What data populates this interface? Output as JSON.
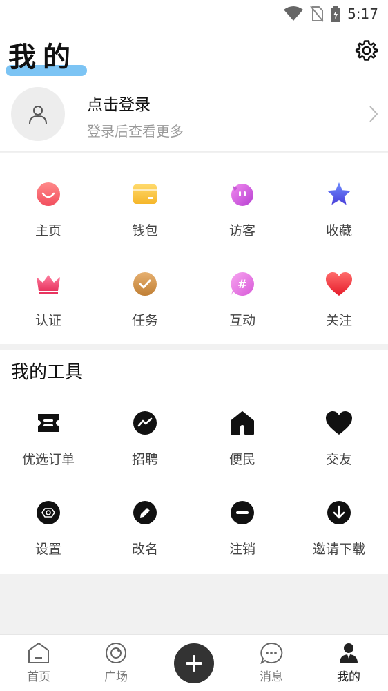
{
  "status_bar": {
    "time": "5:17"
  },
  "header": {
    "title": "我的"
  },
  "profile": {
    "title": "点击登录",
    "subtitle": "登录后查看更多"
  },
  "quick_items": [
    {
      "label": "主页",
      "icon": "smile-icon"
    },
    {
      "label": "钱包",
      "icon": "wallet-icon"
    },
    {
      "label": "访客",
      "icon": "visitor-icon"
    },
    {
      "label": "收藏",
      "icon": "star-icon"
    },
    {
      "label": "认证",
      "icon": "crown-icon"
    },
    {
      "label": "任务",
      "icon": "check-icon"
    },
    {
      "label": "互动",
      "icon": "hashtag-icon"
    },
    {
      "label": "关注",
      "icon": "heart-icon"
    }
  ],
  "tools": {
    "title": "我的工具",
    "items": [
      {
        "label": "优选订单",
        "icon": "ticket-icon"
      },
      {
        "label": "招聘",
        "icon": "trend-icon"
      },
      {
        "label": "便民",
        "icon": "home-icon"
      },
      {
        "label": "交友",
        "icon": "heart-icon"
      },
      {
        "label": "设置",
        "icon": "hexagon-icon"
      },
      {
        "label": "改名",
        "icon": "pencil-icon"
      },
      {
        "label": "注销",
        "icon": "minus-icon"
      },
      {
        "label": "邀请下载",
        "icon": "download-icon"
      }
    ]
  },
  "tabbar": {
    "tabs": [
      {
        "label": "首页",
        "icon": "home-outline-icon"
      },
      {
        "label": "广场",
        "icon": "square-icon"
      },
      {
        "label": "消息",
        "icon": "message-icon"
      },
      {
        "label": "我的",
        "icon": "person-icon"
      }
    ],
    "active": "我的"
  }
}
